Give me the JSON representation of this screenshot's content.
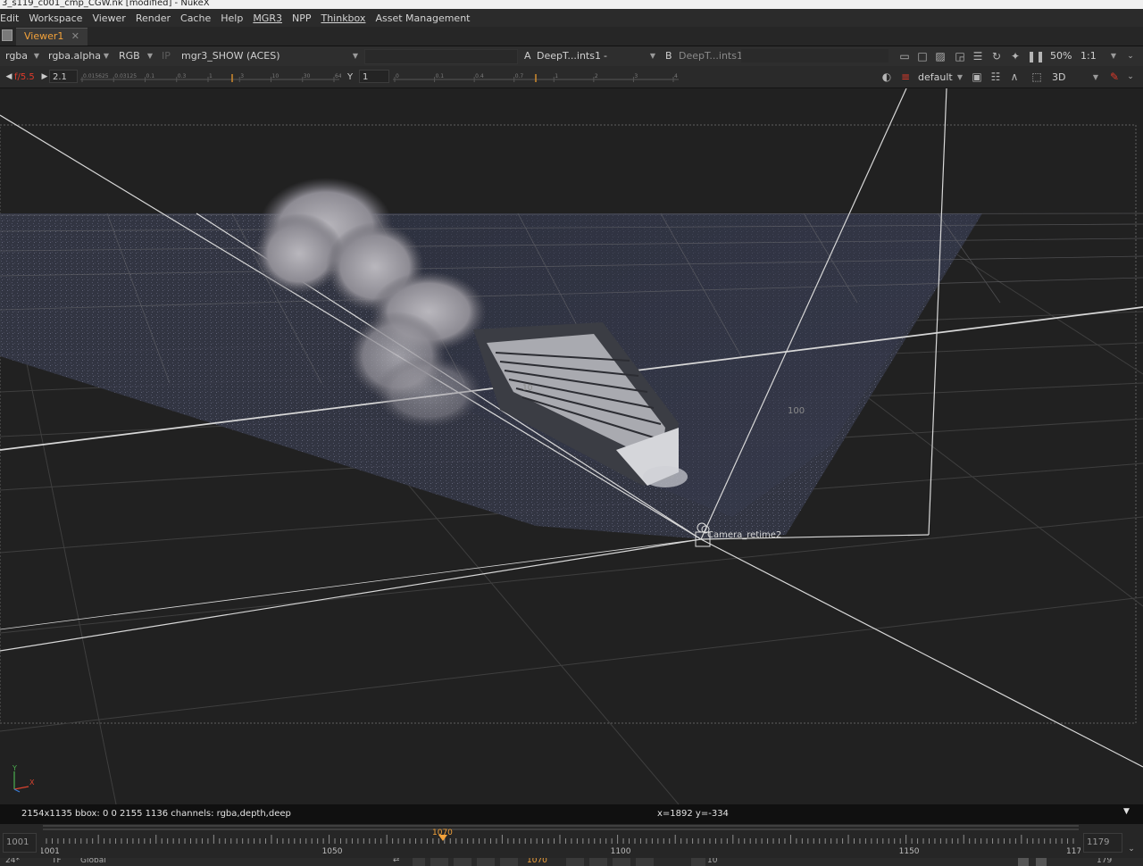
{
  "window": {
    "title": "3_s119_c001_cmp_CGW.nk [modified] - NukeX"
  },
  "menu": [
    "Edit",
    "Workspace",
    "Viewer",
    "Render",
    "Cache",
    "Help",
    "MGR3",
    "NPP",
    "Thinkbox",
    "Asset Management"
  ],
  "tab": {
    "label": "Viewer1",
    "close": "✕"
  },
  "toolbar1": {
    "channels": "rgba",
    "alpha": "rgba.alpha",
    "display_channels": "RGB",
    "ip_label": "IP",
    "lut": "mgr3_SHOW (ACES)",
    "a_label": "A",
    "a_input": "DeepT...ints1",
    "a_op": "-",
    "b_label": "B",
    "b_input": "DeepT...ints1",
    "zoom": "50%",
    "ratio": "1:1"
  },
  "toolbar2": {
    "fstop": "f/5.5",
    "gain": "2.1",
    "gain_ticks": [
      "0.015625",
      "0.03125",
      "0.1",
      "0.3",
      "1",
      "3",
      "10",
      "30",
      "64"
    ],
    "gamma_label": "Y",
    "gamma": "1",
    "gamma_ticks": [
      "0",
      "0.1",
      "0.4",
      "0.7",
      "1",
      "2",
      "3",
      "4"
    ],
    "view_preset": "default",
    "mode": "3D"
  },
  "viewport": {
    "camera_label": "Camera_retime2",
    "grid_labels": [
      "10",
      "100"
    ],
    "axis_y": "Y",
    "axis_x": "X"
  },
  "infobar": {
    "format": "2154x1135  bbox: 0 0 2155 1136 channels: rgba,depth,deep",
    "coords": "x=1892 y=-334"
  },
  "timeline": {
    "start": "1001",
    "end": "1179",
    "current": "1070",
    "labels": [
      "1001",
      "1050",
      "1100",
      "1150",
      "1179"
    ],
    "bottom_left": "24*",
    "bottom_tf": "TF",
    "bottom_global": "Global",
    "bottom_frame": "1070",
    "bottom_step": "10",
    "bottom_right": "179"
  },
  "colors": {
    "accent": "#f3a23a",
    "fstop": "#e03a2a",
    "background": "#212121"
  }
}
